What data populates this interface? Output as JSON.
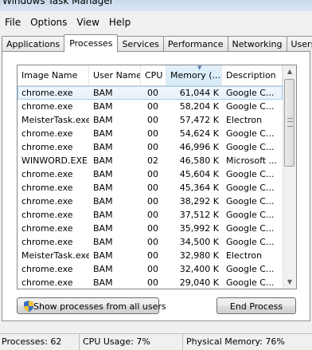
{
  "window": {
    "title": "Windows Task Manager"
  },
  "menu": [
    "File",
    "Options",
    "View",
    "Help"
  ],
  "tabs": [
    "Applications",
    "Processes",
    "Services",
    "Performance",
    "Networking",
    "Users"
  ],
  "active_tab": "Processes",
  "columns": [
    "Image Name",
    "User Name",
    "CPU",
    "Memory (...",
    "Description"
  ],
  "sorted_column": "Memory (...",
  "processes": [
    {
      "image": "chrome.exe",
      "user": "BAM",
      "cpu": "00",
      "memory": "61,044 K",
      "description": "Google C..."
    },
    {
      "image": "chrome.exe",
      "user": "BAM",
      "cpu": "00",
      "memory": "58,204 K",
      "description": "Google C..."
    },
    {
      "image": "MeisterTask.exe",
      "user": "BAM",
      "cpu": "00",
      "memory": "57,472 K",
      "description": "Electron"
    },
    {
      "image": "chrome.exe",
      "user": "BAM",
      "cpu": "00",
      "memory": "54,624 K",
      "description": "Google C..."
    },
    {
      "image": "chrome.exe",
      "user": "BAM",
      "cpu": "00",
      "memory": "46,996 K",
      "description": "Google C..."
    },
    {
      "image": "WINWORD.EXE",
      "user": "BAM",
      "cpu": "02",
      "memory": "46,580 K",
      "description": "Microsoft ..."
    },
    {
      "image": "chrome.exe",
      "user": "BAM",
      "cpu": "00",
      "memory": "45,604 K",
      "description": "Google C..."
    },
    {
      "image": "chrome.exe",
      "user": "BAM",
      "cpu": "00",
      "memory": "45,364 K",
      "description": "Google C..."
    },
    {
      "image": "chrome.exe",
      "user": "BAM",
      "cpu": "00",
      "memory": "38,292 K",
      "description": "Google C..."
    },
    {
      "image": "chrome.exe",
      "user": "BAM",
      "cpu": "00",
      "memory": "37,512 K",
      "description": "Google C..."
    },
    {
      "image": "chrome.exe",
      "user": "BAM",
      "cpu": "00",
      "memory": "35,992 K",
      "description": "Google C..."
    },
    {
      "image": "chrome.exe",
      "user": "BAM",
      "cpu": "00",
      "memory": "34,500 K",
      "description": "Google C..."
    },
    {
      "image": "MeisterTask.exe",
      "user": "BAM",
      "cpu": "00",
      "memory": "32,980 K",
      "description": "Electron"
    },
    {
      "image": "chrome.exe",
      "user": "BAM",
      "cpu": "00",
      "memory": "32,400 K",
      "description": "Google C..."
    },
    {
      "image": "chrome.exe",
      "user": "BAM",
      "cpu": "00",
      "memory": "29,040 K",
      "description": "Google C..."
    }
  ],
  "selected_row": 0,
  "buttons": {
    "show_all": "Show processes from all users",
    "end_process": "End Process"
  },
  "status": {
    "processes": "Processes: 62",
    "cpu": "CPU Usage: 7%",
    "memory": "Physical Memory: 76%"
  },
  "icons": {
    "shield": "uac-shield-icon"
  },
  "colors": {
    "selection": "#e5f1fb",
    "selection_border": "#a8d0f0",
    "sorted_header": "#d5eaf8"
  }
}
